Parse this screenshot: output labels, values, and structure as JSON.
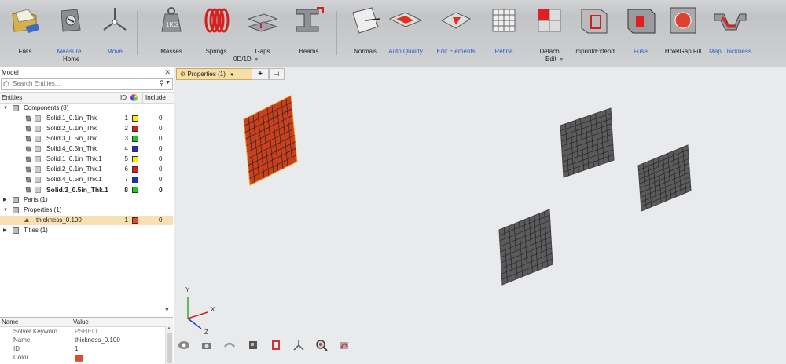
{
  "ribbon": {
    "tools": [
      {
        "label": "Files",
        "icon": "folder-files-icon",
        "blue": false
      },
      {
        "label": "Measure",
        "icon": "measure-icon",
        "blue": true
      },
      {
        "label": "Move",
        "icon": "move-axes-icon",
        "blue": true
      },
      {
        "label": "Masses",
        "icon": "mass-weight-icon",
        "blue": false
      },
      {
        "label": "Springs",
        "icon": "spring-coil-icon",
        "blue": false
      },
      {
        "label": "Gaps",
        "icon": "gap-block-icon",
        "blue": false
      },
      {
        "label": "Beams",
        "icon": "beam-section-icon",
        "blue": false
      },
      {
        "label": "Normals",
        "icon": "normals-icon",
        "blue": false
      },
      {
        "label": "Auto Quality",
        "icon": "auto-quality-icon",
        "blue": true
      },
      {
        "label": "Edit Elements",
        "icon": "edit-elements-icon",
        "blue": true
      },
      {
        "label": "Refine",
        "icon": "refine-mesh-icon",
        "blue": true
      },
      {
        "label": "Detach",
        "icon": "detach-icon",
        "blue": false
      },
      {
        "label": "Imprint/Extend",
        "icon": "imprint-extend-icon",
        "blue": false
      },
      {
        "label": "Fuse",
        "icon": "fuse-icon",
        "blue": true
      },
      {
        "label": "Hole/Gap Fill",
        "icon": "hole-gap-fill-icon",
        "blue": false
      },
      {
        "label": "Map Thickness",
        "icon": "map-thickness-icon",
        "blue": true
      }
    ],
    "groups": {
      "home": "Home",
      "zero_d_one_d": "0D/1D",
      "edit": "Edit"
    }
  },
  "model_panel": {
    "title": "Model",
    "close": "✕",
    "search_placeholder": "Search Entities...",
    "columns": {
      "entities": "Entities",
      "id": "ID",
      "include": "Include"
    },
    "tree": [
      {
        "kind": "folder",
        "label": "Components (8)",
        "expanded": true,
        "icon": "components-icon"
      },
      {
        "kind": "comp",
        "label": "Solid.1_0.1in_Thk",
        "id": "1",
        "color": "#f2ef00",
        "include": "0"
      },
      {
        "kind": "comp",
        "label": "Solid.2_0.1in_Thk",
        "id": "2",
        "color": "#e01b1b",
        "include": "0"
      },
      {
        "kind": "comp",
        "label": "Solid.3_0.5in_Thk",
        "id": "3",
        "color": "#22c822",
        "include": "0"
      },
      {
        "kind": "comp",
        "label": "Solid.4_0.5in_Thk",
        "id": "4",
        "color": "#1a2ee0",
        "include": "0"
      },
      {
        "kind": "comp",
        "label": "Solid.1_0.1in_Thk.1",
        "id": "5",
        "color": "#f2ef00",
        "include": "0"
      },
      {
        "kind": "comp",
        "label": "Solid.2_0.1in_Thk.1",
        "id": "6",
        "color": "#e01b1b",
        "include": "0"
      },
      {
        "kind": "comp",
        "label": "Solid.4_0.5in_Thk.1",
        "id": "7",
        "color": "#1a2ee0",
        "include": "0"
      },
      {
        "kind": "comp",
        "label": "Solid.3_0.5in_Thk.1",
        "id": "8",
        "color": "#22c822",
        "include": "0",
        "bold": true
      },
      {
        "kind": "folder",
        "label": "Parts (1)",
        "expanded": false,
        "icon": "parts-icon"
      },
      {
        "kind": "folder",
        "label": "Properties (1)",
        "expanded": true,
        "icon": "properties-icon"
      },
      {
        "kind": "prop",
        "label": "thickness_0.100",
        "id": "1",
        "color": "#e34a2a",
        "include": "0",
        "selected": true
      },
      {
        "kind": "folder",
        "label": "Titles (1)",
        "expanded": false,
        "icon": "titles-icon"
      }
    ]
  },
  "entity_editor": {
    "header": {
      "name": "Name",
      "value": "Value"
    },
    "rows": [
      {
        "key": "Solver Keyword",
        "value": "PSHELL",
        "gray": true
      },
      {
        "key": "Name",
        "value": "thickness_0.100"
      },
      {
        "key": "ID",
        "value": "1"
      },
      {
        "key": "Color",
        "value": "",
        "swatch": "#e34a2a"
      }
    ]
  },
  "viewport": {
    "tabs": {
      "properties": "Properties (1)",
      "add": "+",
      "pin": "⊣"
    },
    "axes": {
      "y": "Y",
      "x": "X",
      "z": "Z"
    },
    "highlight_color": "#c8401e",
    "mesh_color": "#5b5b5d",
    "bottom_tools": [
      "visualization-icon",
      "camera-icon",
      "undo-view-icon",
      "box-view-icon",
      "mask-icon",
      "axes-icon",
      "zoom-icon",
      "rotate-icon"
    ]
  }
}
